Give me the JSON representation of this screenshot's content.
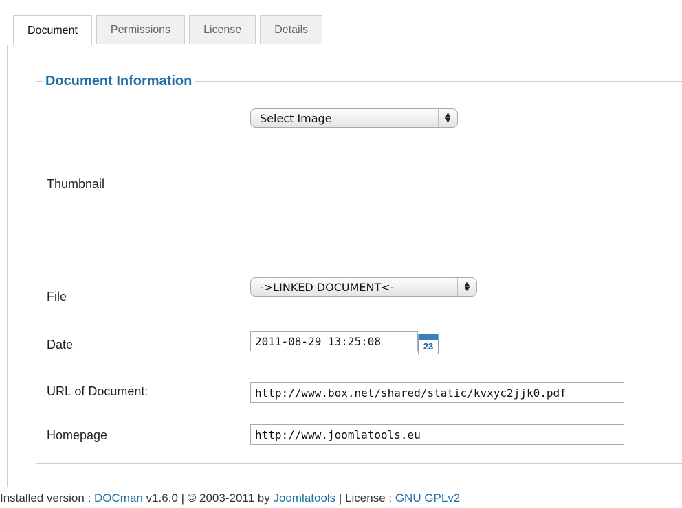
{
  "tabs": [
    {
      "label": "Document",
      "active": true
    },
    {
      "label": "Permissions",
      "active": false
    },
    {
      "label": "License",
      "active": false
    },
    {
      "label": "Details",
      "active": false
    }
  ],
  "fieldset": {
    "legend": "Document Information"
  },
  "thumbnail": {
    "select_value": "Select Image",
    "label": "Thumbnail"
  },
  "file": {
    "label": "File",
    "select_value": "->LINKED DOCUMENT<-"
  },
  "date": {
    "label": "Date",
    "value": "2011-08-29 13:25:08",
    "calendar_icon_text": "23"
  },
  "url": {
    "label": "URL of Document:",
    "value": "http://www.box.net/shared/static/kvxyc2jjk0.pdf"
  },
  "homepage": {
    "label": "Homepage",
    "value": "http://www.joomlatools.eu"
  },
  "footer": {
    "prefix": "Installed version : ",
    "product_link": "DOCman",
    "version_text": " v1.6.0 | © 2003-2011 by ",
    "vendor_link": "Joomlatools",
    "license_text": " | License : ",
    "license_link": "GNU GPLv2"
  },
  "colors": {
    "accent": "#1f6fa5",
    "border": "#cfcfcf"
  }
}
